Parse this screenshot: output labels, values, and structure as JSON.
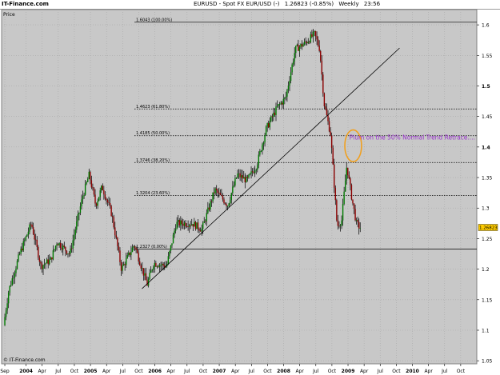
{
  "header": {
    "brand": "IT-Finance.com",
    "symbol": "EURUSD - Spot FX EUR/USD (-)",
    "quote": "1.26823 (-0.85%)",
    "period": "Weekly",
    "time": "23:56"
  },
  "colors": {
    "plot_bg": "#c8c8c8",
    "grid": "#a8a8a8",
    "up_candle": "#007a00",
    "down_candle": "#8b0000",
    "wick": "#000000",
    "fib_line": "#000000",
    "trendline": "#000000",
    "annotation_text": "#9933cc",
    "ellipse": "#f0a020",
    "last_price_bg": "#ffcc00"
  },
  "chart_data": {
    "type": "candlestick",
    "panel_label": "Price",
    "watermark": "© IT-Finance.com",
    "y_axis": {
      "range": [
        1.045,
        1.625
      ],
      "ticks": [
        "1.6",
        "1.55",
        "1.5",
        "1.45",
        "1.4",
        "1.35",
        "1.3",
        "1.25",
        "1.2",
        "1.15",
        "1.1",
        "1.05"
      ],
      "bold_ticks": [
        "1.5",
        "1.4"
      ]
    },
    "x_axis": {
      "ticks": [
        {
          "label": "Sep",
          "t": 2003.67
        },
        {
          "label": "2004",
          "t": 2004.0,
          "bold": true
        },
        {
          "label": "Apr",
          "t": 2004.25
        },
        {
          "label": "Jul",
          "t": 2004.5
        },
        {
          "label": "Oct",
          "t": 2004.75
        },
        {
          "label": "2005",
          "t": 2005.0,
          "bold": true
        },
        {
          "label": "Apr",
          "t": 2005.25
        },
        {
          "label": "Jul",
          "t": 2005.5
        },
        {
          "label": "Oct",
          "t": 2005.75
        },
        {
          "label": "2006",
          "t": 2006.0,
          "bold": true
        },
        {
          "label": "Apr",
          "t": 2006.25
        },
        {
          "label": "Jul",
          "t": 2006.5
        },
        {
          "label": "Oct",
          "t": 2006.75
        },
        {
          "label": "2007",
          "t": 2007.0,
          "bold": true
        },
        {
          "label": "Apr",
          "t": 2007.25
        },
        {
          "label": "Jul",
          "t": 2007.5
        },
        {
          "label": "Oct",
          "t": 2007.75
        },
        {
          "label": "2008",
          "t": 2008.0,
          "bold": true
        },
        {
          "label": "Apr",
          "t": 2008.25
        },
        {
          "label": "Jul",
          "t": 2008.5
        },
        {
          "label": "Oct",
          "t": 2008.75
        },
        {
          "label": "2009",
          "t": 2009.0,
          "bold": true
        },
        {
          "label": "Apr",
          "t": 2009.25
        },
        {
          "label": "Jul",
          "t": 2009.5
        },
        {
          "label": "Oct",
          "t": 2009.75
        },
        {
          "label": "2010",
          "t": 2010.0,
          "bold": true
        },
        {
          "label": "Apr",
          "t": 2010.25
        },
        {
          "label": "Jul",
          "t": 2010.5
        },
        {
          "label": "Oct",
          "t": 2010.75
        }
      ]
    },
    "last_price": {
      "label": "1.26823",
      "value": 1.26823
    },
    "fib_levels": [
      {
        "label": "1.6043 (100.00%)",
        "value": 1.6043
      },
      {
        "label": "1.4623 (61.80%)",
        "value": 1.4623
      },
      {
        "label": "1.4185 (50.00%)",
        "value": 1.4185
      },
      {
        "label": "1.3746 (38.20%)",
        "value": 1.3746
      },
      {
        "label": "1.3204 (23.60%)",
        "value": 1.3204
      },
      {
        "label": "1.2327 (0.00%)",
        "value": 1.2327
      }
    ],
    "trendline": {
      "t1": 2005.8,
      "v1": 1.168,
      "t2": 2009.8,
      "v2": 1.562
    },
    "annotation": {
      "text": "Plum on the 50% Normal Trend Retrace....",
      "t": 2009.02,
      "v": 1.402
    },
    "ellipse": {
      "t": 2009.08,
      "v": 1.402,
      "dt": 0.13,
      "dv": 0.026
    },
    "price_path": [
      {
        "t": 2003.67,
        "v": 1.108
      },
      {
        "t": 2003.75,
        "v": 1.165
      },
      {
        "t": 2003.92,
        "v": 1.225
      },
      {
        "t": 2004.1,
        "v": 1.275
      },
      {
        "t": 2004.25,
        "v": 1.205
      },
      {
        "t": 2004.4,
        "v": 1.215
      },
      {
        "t": 2004.5,
        "v": 1.245
      },
      {
        "t": 2004.7,
        "v": 1.225
      },
      {
        "t": 2004.9,
        "v": 1.32
      },
      {
        "t": 2005.0,
        "v": 1.355
      },
      {
        "t": 2005.1,
        "v": 1.305
      },
      {
        "t": 2005.2,
        "v": 1.335
      },
      {
        "t": 2005.35,
        "v": 1.29
      },
      {
        "t": 2005.5,
        "v": 1.2
      },
      {
        "t": 2005.7,
        "v": 1.24
      },
      {
        "t": 2005.9,
        "v": 1.175
      },
      {
        "t": 2006.0,
        "v": 1.21
      },
      {
        "t": 2006.2,
        "v": 1.205
      },
      {
        "t": 2006.35,
        "v": 1.275
      },
      {
        "t": 2006.6,
        "v": 1.275
      },
      {
        "t": 2006.75,
        "v": 1.265
      },
      {
        "t": 2006.95,
        "v": 1.33
      },
      {
        "t": 2007.15,
        "v": 1.305
      },
      {
        "t": 2007.3,
        "v": 1.355
      },
      {
        "t": 2007.45,
        "v": 1.345
      },
      {
        "t": 2007.6,
        "v": 1.37
      },
      {
        "t": 2007.75,
        "v": 1.43
      },
      {
        "t": 2007.92,
        "v": 1.465
      },
      {
        "t": 2008.05,
        "v": 1.48
      },
      {
        "t": 2008.2,
        "v": 1.56
      },
      {
        "t": 2008.35,
        "v": 1.57
      },
      {
        "t": 2008.5,
        "v": 1.585
      },
      {
        "t": 2008.58,
        "v": 1.56
      },
      {
        "t": 2008.65,
        "v": 1.47
      },
      {
        "t": 2008.75,
        "v": 1.42
      },
      {
        "t": 2008.85,
        "v": 1.27
      },
      {
        "t": 2008.92,
        "v": 1.28
      },
      {
        "t": 2009.0,
        "v": 1.37
      },
      {
        "t": 2009.08,
        "v": 1.315
      },
      {
        "t": 2009.15,
        "v": 1.275
      },
      {
        "t": 2009.2,
        "v": 1.268
      }
    ]
  }
}
